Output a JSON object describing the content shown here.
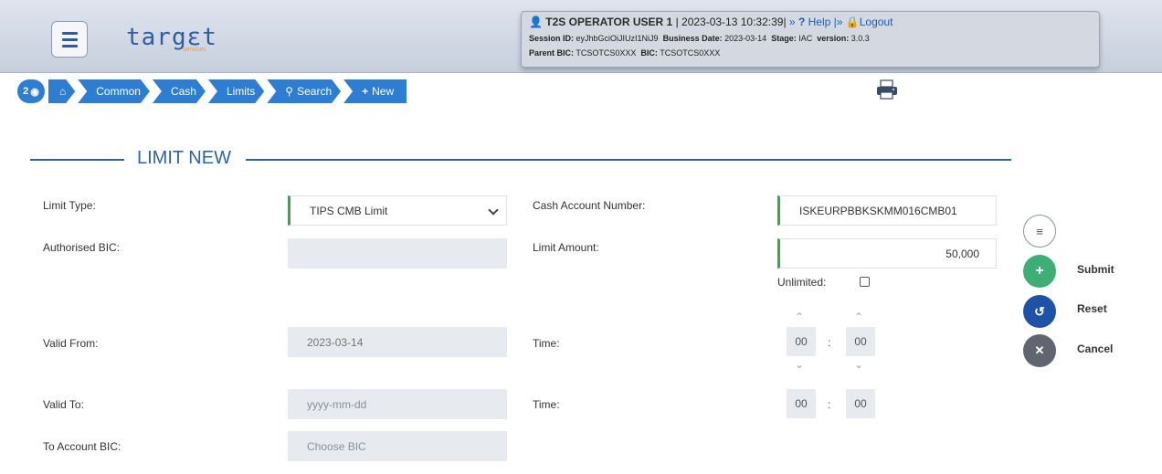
{
  "header": {
    "logo_text": "targεt",
    "logo_sub": "services",
    "menu_icon": "hamburger-icon"
  },
  "session": {
    "user": "T2S OPERATOR USER 1",
    "datetime": "| 2023-03-13 10:32:39|",
    "help_prefix": "»",
    "help_label": "Help",
    "logout_prefix": "|»",
    "logout_label": "Logout",
    "session_id_label": "Session ID:",
    "session_id": "eyJhbGciOiJIUzI1NiJ9",
    "business_date_label": "Business Date:",
    "business_date": "2023-03-14",
    "stage_label": "Stage:",
    "stage": "IAC",
    "version_label": "version:",
    "version": "3.0.3",
    "parent_bic_label": "Parent BIC:",
    "parent_bic": "TCSOTCS0XXX",
    "bic_label": "BIC:",
    "bic": "TCSOTCS0XXX"
  },
  "breadcrumb": {
    "badge": "2",
    "items": [
      "Common",
      "Cash",
      "Limits",
      "Search",
      "New"
    ]
  },
  "section": {
    "title": "LIMIT NEW"
  },
  "form": {
    "limit_type_label": "Limit Type:",
    "limit_type_value": "TIPS CMB Limit",
    "authorised_bic_label": "Authorised BIC:",
    "authorised_bic_value": "",
    "cash_account_label": "Cash Account Number:",
    "cash_account_value": "ISKEURPBBKSKMM016CMB01",
    "limit_amount_label": "Limit Amount:",
    "limit_amount_value": "50,000",
    "unlimited_label": "Unlimited:",
    "valid_from_label": "Valid From:",
    "valid_from_value": "2023-03-14",
    "time_label": "Time:",
    "time_from_hour": "00",
    "time_from_min": "00",
    "valid_to_label": "Valid To:",
    "valid_to_placeholder": "yyyy-mm-dd",
    "time_to_hour": "00",
    "time_to_min": "00",
    "to_account_bic_label": "To Account BIC:",
    "to_account_bic_placeholder": "Choose BIC",
    "colon": ":"
  },
  "actions": {
    "submit": "Submit",
    "reset": "Reset",
    "cancel": "Cancel"
  },
  "colors": {
    "primary": "#2d7dd2",
    "submit": "#3dae74",
    "reset": "#1d52a8",
    "cancel": "#5f6670"
  }
}
